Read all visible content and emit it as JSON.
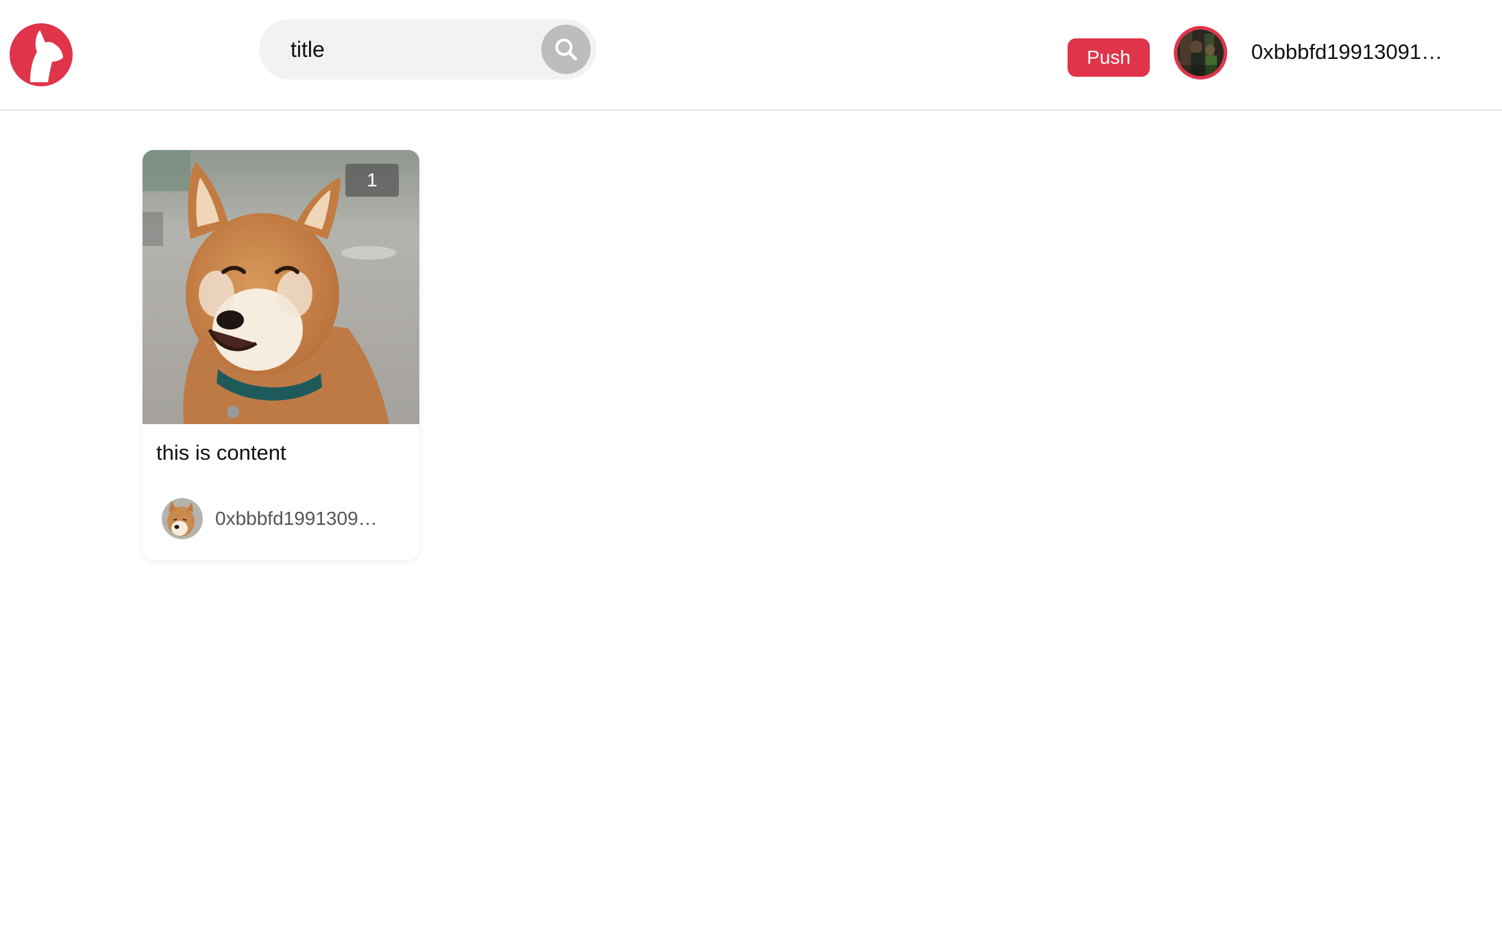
{
  "header": {
    "logo_icon": "dog-head-logo-icon",
    "search": {
      "value": "title",
      "icon": "search-icon"
    },
    "push_label": "Push",
    "user": {
      "avatar_icon": "user-avatar",
      "name": "0xbbbfd19913091…"
    }
  },
  "colors": {
    "accent": "#e0344a",
    "search_bg": "#f2f2f2",
    "search_button": "#bdbdbd"
  },
  "feed": {
    "cards": [
      {
        "image": "shiba-inu-photo",
        "count_badge": "1",
        "content": "this is content",
        "author": {
          "avatar": "shiba-inu-avatar",
          "name": "0xbbbfd1991309…"
        }
      }
    ]
  }
}
